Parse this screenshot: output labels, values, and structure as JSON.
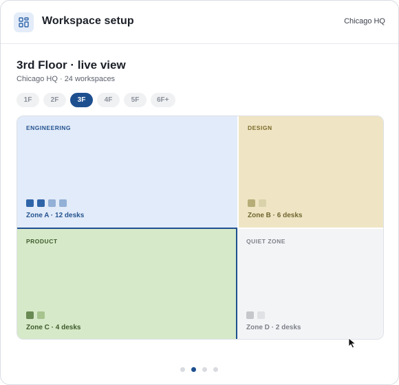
{
  "header": {
    "app_icon": "grid-layout-icon",
    "title": "Workspace setup",
    "location": "Chicago HQ"
  },
  "floor": {
    "title": "3rd Floor · live view",
    "subtitle": "Chicago HQ · 24 workspaces"
  },
  "floor_tabs": [
    {
      "label": "1F",
      "active": false
    },
    {
      "label": "2F",
      "active": false
    },
    {
      "label": "3F",
      "active": true
    },
    {
      "label": "4F",
      "active": false
    },
    {
      "label": "5F",
      "active": false
    },
    {
      "label": "6F+",
      "active": false
    }
  ],
  "zones": {
    "a": {
      "name": "ENGINEERING",
      "caption": "Zone A · 12 desks",
      "desk_colors": [
        "#2f64a8",
        "#2f64a8",
        "#93b0d6",
        "#93b0d6"
      ]
    },
    "b": {
      "name": "DESIGN",
      "caption": "Zone B · 6 desks",
      "desk_colors": [
        "#b6ad78",
        "#d9d2ab"
      ]
    },
    "c": {
      "name": "PRODUCT",
      "caption": "Zone C · 4 desks",
      "desk_colors": [
        "#6a8a54",
        "#a7c38e"
      ]
    },
    "d": {
      "name": "QUIET ZONE",
      "caption": "Zone D · 2 desks",
      "desk_colors": [
        "#c5c7cb",
        "#e0e1e4"
      ]
    }
  },
  "pager": {
    "count": 4,
    "active_index": 1
  },
  "colors": {
    "accent": "#1d4f8f",
    "engineering": "#e2ebf9",
    "design": "#efe5c4",
    "product": "#d6e9c8",
    "quiet": "#f3f4f6"
  },
  "cursor_icon": "mouse-pointer-icon"
}
